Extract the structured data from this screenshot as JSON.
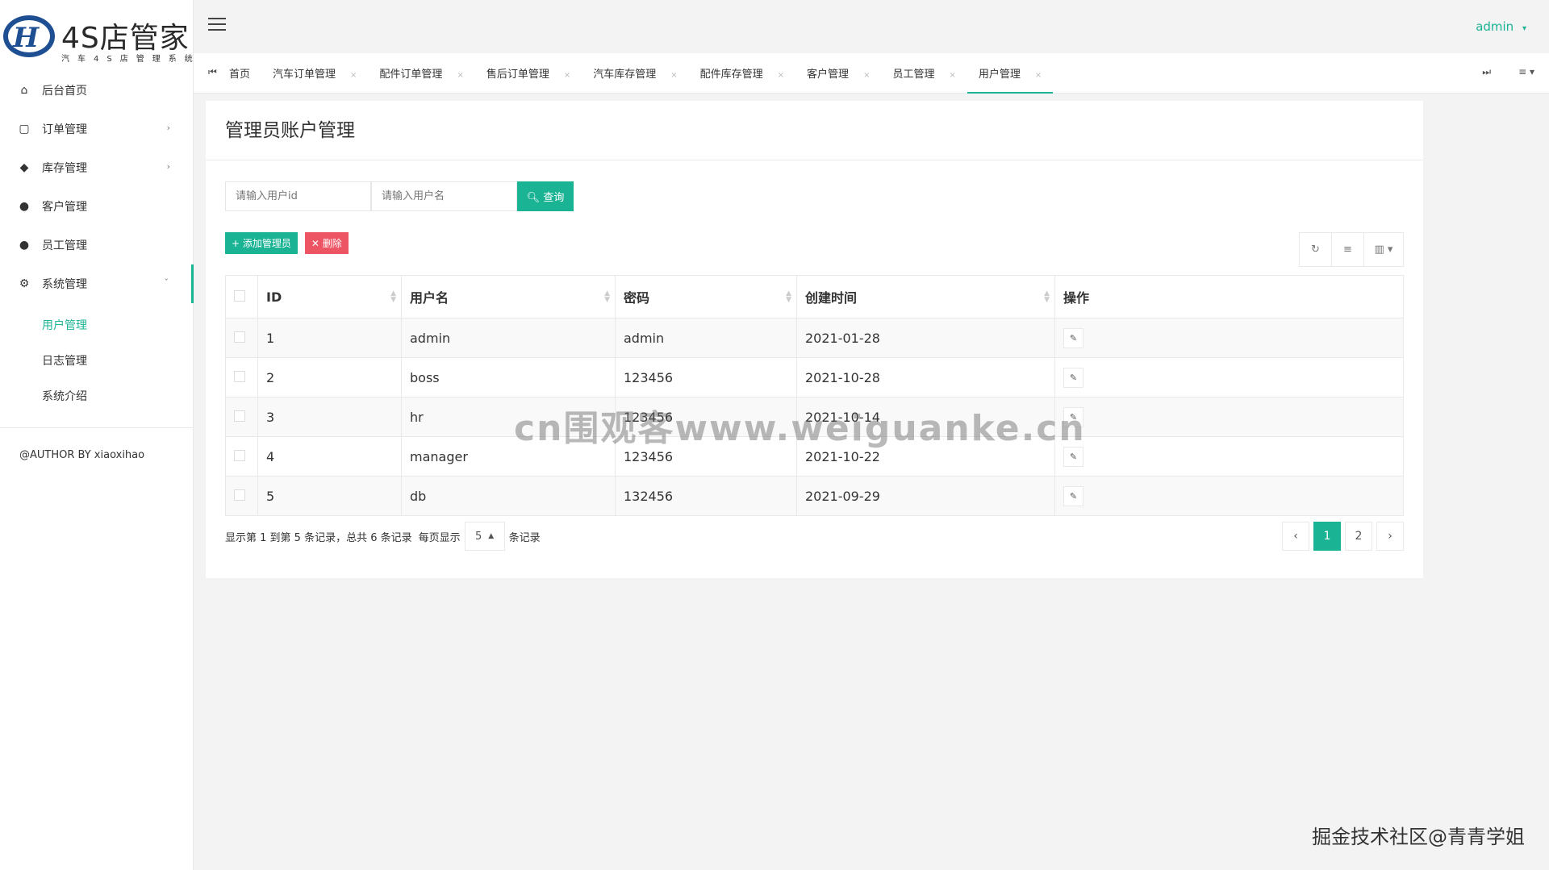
{
  "brand": {
    "title": "4S店管家",
    "subtitle": "汽车4S店管理系统"
  },
  "user": {
    "name": "admin"
  },
  "sidebar": {
    "items": [
      {
        "label": "后台首页",
        "icon": "home-icon"
      },
      {
        "label": "订单管理",
        "icon": "clipboard-icon"
      },
      {
        "label": "库存管理",
        "icon": "cube-icon"
      },
      {
        "label": "客户管理",
        "icon": "users-icon"
      },
      {
        "label": "员工管理",
        "icon": "user-icon"
      },
      {
        "label": "系统管理",
        "icon": "gear-icon"
      }
    ],
    "subitems": [
      {
        "label": "用户管理"
      },
      {
        "label": "日志管理"
      },
      {
        "label": "系统介绍"
      }
    ],
    "author": "@AUTHOR BY xiaoxihao"
  },
  "tabs": [
    {
      "label": "首页"
    },
    {
      "label": "汽车订单管理"
    },
    {
      "label": "配件订单管理"
    },
    {
      "label": "售后订单管理"
    },
    {
      "label": "汽车库存管理"
    },
    {
      "label": "配件库存管理"
    },
    {
      "label": "客户管理"
    },
    {
      "label": "员工管理"
    },
    {
      "label": "用户管理"
    }
  ],
  "page": {
    "title": "管理员账户管理",
    "search": {
      "id_placeholder": "请输入用户id",
      "name_placeholder": "请输入用户名",
      "button": "查询"
    },
    "add_button": "添加管理员",
    "delete_button": "删除"
  },
  "table": {
    "columns": [
      "ID",
      "用户名",
      "密码",
      "创建时间",
      "操作"
    ],
    "rows": [
      {
        "id": "1",
        "username": "admin",
        "password": "admin",
        "created": "2021-01-28"
      },
      {
        "id": "2",
        "username": "boss",
        "password": "123456",
        "created": "2021-10-28"
      },
      {
        "id": "3",
        "username": "hr",
        "password": "123456",
        "created": "2021-10-14"
      },
      {
        "id": "4",
        "username": "manager",
        "password": "123456",
        "created": "2021-10-22"
      },
      {
        "id": "5",
        "username": "db",
        "password": "132456",
        "created": "2021-09-29"
      }
    ]
  },
  "pagination": {
    "info": "显示第 1 到第 5 条记录，总共 6 条记录",
    "per_page_label": "每页显示",
    "per_page_value": "5",
    "per_page_suffix": "条记录",
    "pages": [
      "1",
      "2"
    ],
    "prev": "‹",
    "next": "›"
  },
  "watermark": "cn围观客www.weiguanke.cn",
  "footer_mark": "掘金技术社区@青青学姐",
  "colors": {
    "accent": "#1ab394",
    "danger": "#ed5565"
  }
}
